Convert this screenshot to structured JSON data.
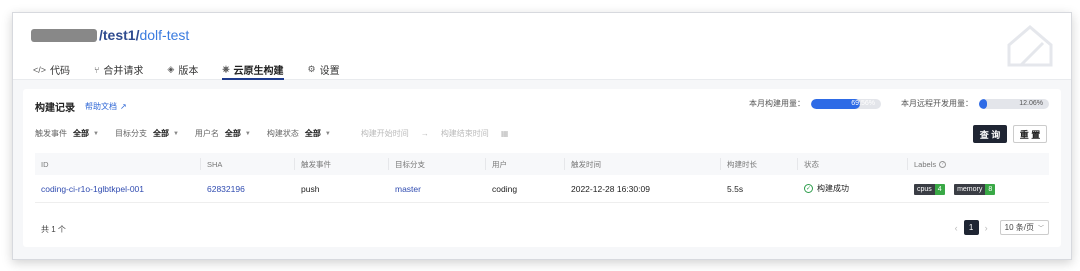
{
  "repo": {
    "owner_masked": true,
    "separator1": "/",
    "team": "test1",
    "separator2": "/",
    "project": "dolf-test"
  },
  "tabs": [
    {
      "icon": "code-icon",
      "glyph": "</>",
      "label": "代码"
    },
    {
      "icon": "merge-request-icon",
      "glyph": "⑂",
      "label": "合并请求"
    },
    {
      "icon": "layers-icon",
      "glyph": "◈",
      "label": "版本"
    },
    {
      "icon": "cloud-native-icon",
      "glyph": "⎈",
      "label": "云原生构建"
    },
    {
      "icon": "gear-icon",
      "glyph": "⚙",
      "label": "设置"
    }
  ],
  "card": {
    "title": "构建记录",
    "help_label": "帮助文档",
    "help_icon": "external-link-icon"
  },
  "usage": {
    "build": {
      "label": "本月构建用量：",
      "percent": 69.56,
      "text": "69.56%"
    },
    "remote": {
      "label": "本月远程开发用量：",
      "percent": 12.06,
      "text": "12.06%"
    }
  },
  "filters": [
    {
      "label": "触发事件",
      "value": "全部"
    },
    {
      "label": "目标分支",
      "value": "全部"
    },
    {
      "label": "用户名",
      "value": "全部"
    },
    {
      "label": "构建状态",
      "value": "全部"
    }
  ],
  "date_range": {
    "start_placeholder": "构建开始时间",
    "arrow": "→",
    "end_placeholder": "构建结束时间",
    "icon": "calendar-icon"
  },
  "buttons": {
    "query": "查 询",
    "reset": "重 置"
  },
  "table": {
    "columns": [
      "ID",
      "SHA",
      "触发事件",
      "目标分支",
      "用户",
      "触发时间",
      "构建时长",
      "状态",
      "Labels"
    ],
    "rows": [
      {
        "id": "coding-ci-r1o-1glbtkpel-001",
        "sha": "62832196",
        "event": "push",
        "branch": "master",
        "user": "coding",
        "time": "2022-12-28 16:30:09",
        "duration": "5.5s",
        "status": "构建成功",
        "labels": [
          {
            "key": "cpus",
            "value": "4"
          },
          {
            "key": "memory",
            "value": "8"
          }
        ]
      }
    ]
  },
  "footer": {
    "total": "共 1 个",
    "prev": "‹",
    "page": "1",
    "next": "›",
    "page_size": "10 条/页"
  },
  "colors": {
    "accent": "#2e6be6",
    "primary_button": "#1f2533",
    "success": "#2d9d4b",
    "link": "#2f4bb0"
  }
}
